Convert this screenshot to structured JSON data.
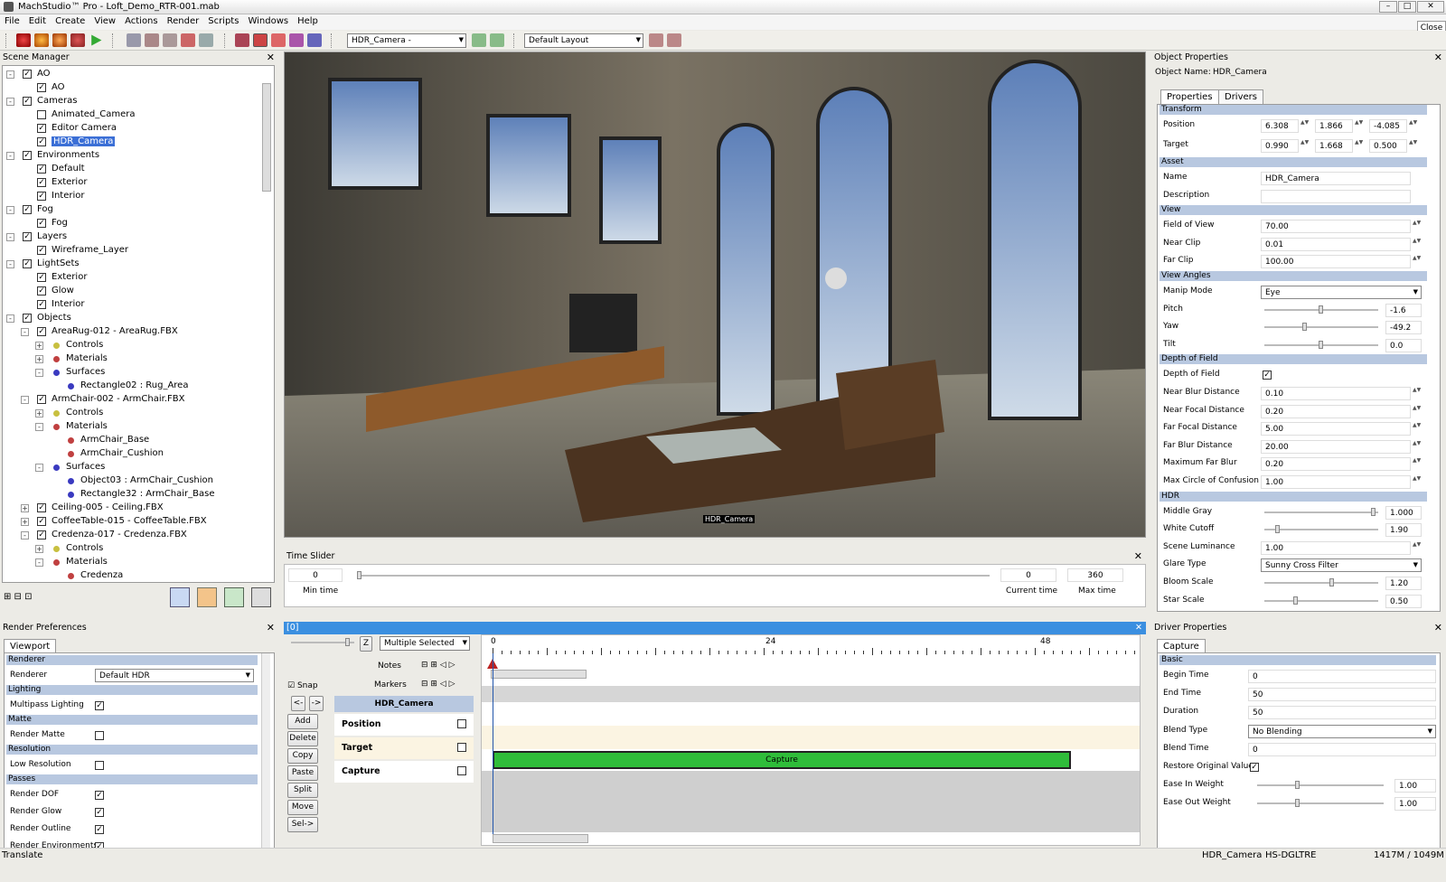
{
  "window": {
    "title": "MachStudio™ Pro - Loft_Demo_RTR-001.mab",
    "close_label": "Close"
  },
  "menu": [
    "File",
    "Edit",
    "Create",
    "View",
    "Actions",
    "Render",
    "Scripts",
    "Windows",
    "Help"
  ],
  "toolbar": {
    "camera": "HDR_Camera -",
    "layout": "Default Layout"
  },
  "scene_manager": {
    "title": "Scene Manager",
    "tree": [
      {
        "label": "AO",
        "level": 0,
        "exp": "-"
      },
      {
        "label": "AO",
        "level": 1
      },
      {
        "label": "Cameras",
        "level": 0,
        "exp": "-"
      },
      {
        "label": "Animated_Camera",
        "level": 1,
        "unchecked": true
      },
      {
        "label": "Editor Camera",
        "level": 1
      },
      {
        "label": "HDR_Camera",
        "level": 1,
        "selected": true
      },
      {
        "label": "Environments",
        "level": 0,
        "exp": "-"
      },
      {
        "label": "Default",
        "level": 1
      },
      {
        "label": "Exterior",
        "level": 1
      },
      {
        "label": "Interior",
        "level": 1
      },
      {
        "label": "Fog",
        "level": 0,
        "exp": "-"
      },
      {
        "label": "Fog",
        "level": 1
      },
      {
        "label": "Layers",
        "level": 0,
        "exp": "-"
      },
      {
        "label": "Wireframe_Layer",
        "level": 1
      },
      {
        "label": "LightSets",
        "level": 0,
        "exp": "-"
      },
      {
        "label": "Exterior",
        "level": 1
      },
      {
        "label": "Glow",
        "level": 1
      },
      {
        "label": "Interior",
        "level": 1
      },
      {
        "label": "Objects",
        "level": 0,
        "exp": "-"
      },
      {
        "label": "AreaRug-012 - AreaRug.FBX",
        "level": 1,
        "exp": "-"
      },
      {
        "label": "Controls",
        "level": 2,
        "dot": "#c8c040",
        "exp": "+"
      },
      {
        "label": "Materials",
        "level": 2,
        "dot": "#c04040",
        "exp": "+"
      },
      {
        "label": "Surfaces",
        "level": 2,
        "dot": "#3a3ac0",
        "exp": "-"
      },
      {
        "label": "Rectangle02 : Rug_Area",
        "level": 3,
        "dot": "#3a3ac0"
      },
      {
        "label": "ArmChair-002 - ArmChair.FBX",
        "level": 1,
        "exp": "-"
      },
      {
        "label": "Controls",
        "level": 2,
        "dot": "#c8c040",
        "exp": "+"
      },
      {
        "label": "Materials",
        "level": 2,
        "dot": "#c04040",
        "exp": "-"
      },
      {
        "label": "ArmChair_Base",
        "level": 3,
        "dot": "#c04040"
      },
      {
        "label": "ArmChair_Cushion",
        "level": 3,
        "dot": "#c04040"
      },
      {
        "label": "Surfaces",
        "level": 2,
        "dot": "#3a3ac0",
        "exp": "-"
      },
      {
        "label": "Object03 : ArmChair_Cushion",
        "level": 3,
        "dot": "#3a3ac0"
      },
      {
        "label": "Rectangle32 : ArmChair_Base",
        "level": 3,
        "dot": "#3a3ac0"
      },
      {
        "label": "Ceiling-005 - Ceiling.FBX",
        "level": 1,
        "exp": "+"
      },
      {
        "label": "CoffeeTable-015 - CoffeeTable.FBX",
        "level": 1,
        "exp": "+"
      },
      {
        "label": "Credenza-017 - Credenza.FBX",
        "level": 1,
        "exp": "-"
      },
      {
        "label": "Controls",
        "level": 2,
        "dot": "#c8c040",
        "exp": "+"
      },
      {
        "label": "Materials",
        "level": 2,
        "dot": "#c04040",
        "exp": "-"
      },
      {
        "label": "Credenza",
        "level": 3,
        "dot": "#c04040"
      }
    ]
  },
  "viewport": {
    "camera_label": "HDR_Camera"
  },
  "time_slider": {
    "title": "Time Slider",
    "min_time": "0",
    "min_label": "Min time",
    "current_time": "0",
    "current_label": "Current time",
    "max_time": "360",
    "max_label": "Max time"
  },
  "object_properties": {
    "title": "Object Properties",
    "object_name_label": "Object Name:",
    "object_name": "HDR_Camera",
    "tabs": [
      "Properties",
      "Drivers"
    ],
    "sections": [
      {
        "name": "Transform",
        "rows": [
          {
            "label": "Position",
            "xyz": [
              "6.308",
              "1.866",
              "-4.085"
            ]
          },
          {
            "label": "Target",
            "xyz": [
              "0.990",
              "1.668",
              "0.500"
            ]
          }
        ]
      },
      {
        "name": "Asset",
        "rows": [
          {
            "label": "Name",
            "value": "HDR_Camera"
          },
          {
            "label": "Description",
            "value": ""
          }
        ]
      },
      {
        "name": "View",
        "rows": [
          {
            "label": "Field of View",
            "value": "70.00"
          },
          {
            "label": "Near Clip",
            "value": "0.01"
          },
          {
            "label": "Far Clip",
            "value": "100.00"
          }
        ]
      },
      {
        "name": "View Angles",
        "rows": [
          {
            "label": "Manip Mode",
            "value": "Eye",
            "combo": true
          },
          {
            "label": "Pitch",
            "value": "-1.6",
            "slider": 0.5
          },
          {
            "label": "Yaw",
            "value": "-49.2",
            "slider": 0.35
          },
          {
            "label": "Tilt",
            "value": "0.0",
            "slider": 0.5
          }
        ]
      },
      {
        "name": "Depth of Field",
        "rows": [
          {
            "label": "Depth of Field",
            "check": true
          },
          {
            "label": "Near Blur Distance",
            "value": "0.10"
          },
          {
            "label": "Near Focal Distance",
            "value": "0.20"
          },
          {
            "label": "Far Focal Distance",
            "value": "5.00"
          },
          {
            "label": "Far Blur Distance",
            "value": "20.00"
          },
          {
            "label": "Maximum Far Blur",
            "value": "0.20"
          },
          {
            "label": "Max Circle of Confusion",
            "value": "1.00"
          }
        ]
      },
      {
        "name": "HDR",
        "rows": [
          {
            "label": "Middle Gray",
            "value": "1.000",
            "slider": 0.98
          },
          {
            "label": "White Cutoff",
            "value": "1.90",
            "slider": 0.1
          },
          {
            "label": "Scene Luminance",
            "value": "1.00"
          },
          {
            "label": "Glare Type",
            "value": "Sunny Cross Filter",
            "combo": true
          },
          {
            "label": "Bloom Scale",
            "value": "1.20",
            "slider": 0.6
          },
          {
            "label": "Star Scale",
            "value": "0.50",
            "slider": 0.27
          }
        ]
      }
    ]
  },
  "render_prefs": {
    "title": "Render Preferences",
    "tab": "Viewport",
    "rows": [
      {
        "section": "Renderer"
      },
      {
        "label": "Renderer",
        "combo": "Default HDR"
      },
      {
        "section": "Lighting"
      },
      {
        "label": "Multipass Lighting",
        "check": true
      },
      {
        "section": "Matte"
      },
      {
        "label": "Render Matte",
        "check": false
      },
      {
        "section": "Resolution"
      },
      {
        "label": "Low Resolution",
        "check": false
      },
      {
        "section": "Passes"
      },
      {
        "label": "Render DOF",
        "check": true
      },
      {
        "label": "Render Glow",
        "check": true
      },
      {
        "label": "Render Outline",
        "check": true
      },
      {
        "label": "Render Environments",
        "check": true
      }
    ]
  },
  "timeline": {
    "title": "[0]",
    "z_label": "Z",
    "selection": "Multiple Selected",
    "notes": "Notes",
    "markers": "Markers",
    "snap": "Snap",
    "buttons": [
      "Add",
      "Delete",
      "Copy",
      "Paste",
      "Split",
      "Move",
      "Sel->"
    ],
    "nav": [
      "<-",
      "->"
    ],
    "track_header": "HDR_Camera",
    "tracks": [
      "Position",
      "Target",
      "Capture"
    ],
    "ticks": [
      "0",
      "24",
      "48"
    ],
    "clip_label": "Capture"
  },
  "driver_properties": {
    "title": "Driver Properties",
    "tab": "Capture",
    "section": "Basic",
    "rows": [
      {
        "label": "Begin Time",
        "value": "0"
      },
      {
        "label": "End Time",
        "value": "50"
      },
      {
        "label": "Duration",
        "value": "50"
      },
      {
        "label": "Blend Type",
        "value": "No Blending",
        "combo": true
      },
      {
        "label": "Blend Time",
        "value": "0"
      },
      {
        "label": "Restore Original Value",
        "check": true
      },
      {
        "label": "Ease In Weight",
        "value": "1.00",
        "slider": 0.3
      },
      {
        "label": "Ease Out Weight",
        "value": "1.00",
        "slider": 0.3
      }
    ]
  },
  "status": {
    "left": "Translate",
    "camera": "HDR_Camera",
    "host": "HS-DGLTRE",
    "memory": "1417M / 1049M"
  }
}
